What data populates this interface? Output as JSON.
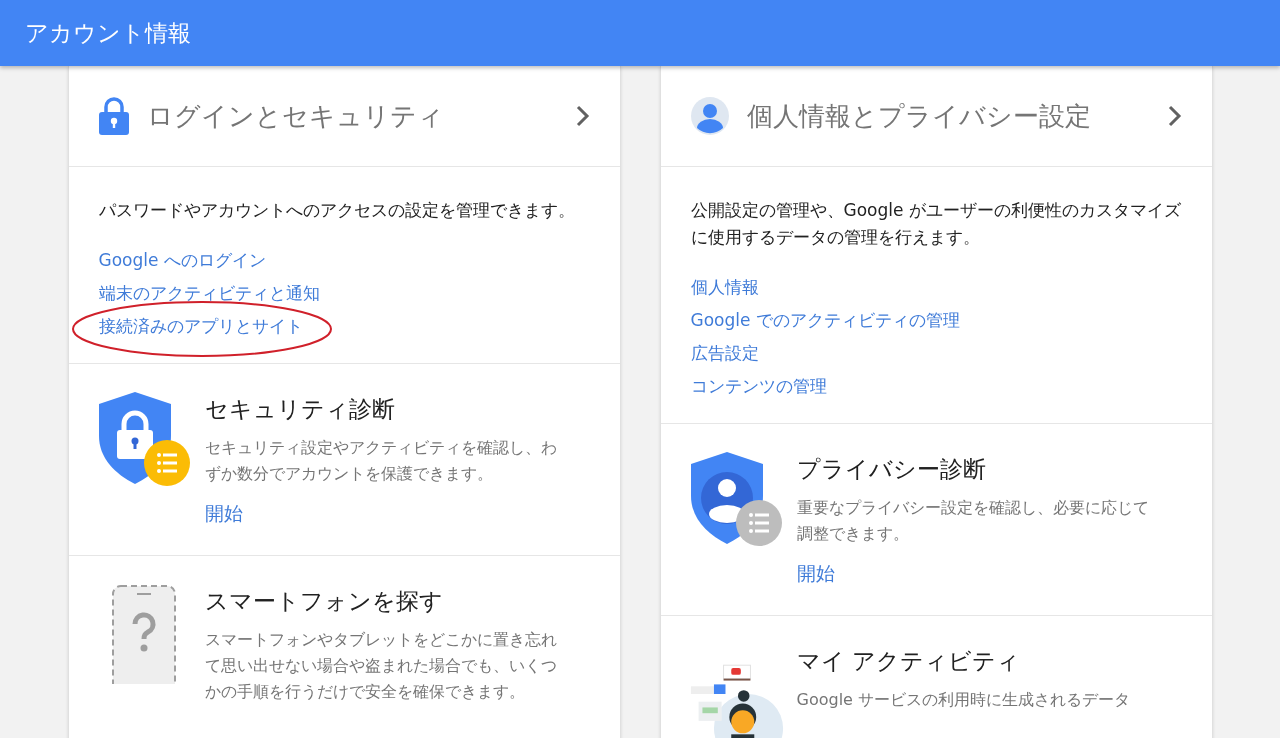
{
  "header": {
    "title": "アカウント情報"
  },
  "cards": [
    {
      "title": "ログインとセキュリティ",
      "kind": "lock",
      "description": "パスワードやアカウントへのアクセスの設定を管理できます。",
      "links": [
        {
          "label": "Google へのログイン",
          "circled": false
        },
        {
          "label": "端末のアクティビティと通知",
          "circled": false
        },
        {
          "label": "接続済みのアプリとサイト",
          "circled": true
        }
      ],
      "features": [
        {
          "kind": "security-shield",
          "title": "セキュリティ診断",
          "description": "セキュリティ設定やアクティビティを確認し、わずか数分でアカウントを保護できます。",
          "action": "開始"
        },
        {
          "kind": "phone",
          "title": "スマートフォンを探す",
          "description": "スマートフォンやタブレットをどこかに置き忘れて思い出せない場合や盗まれた場合でも、いくつかの手順を行うだけで安全を確保できます。"
        }
      ]
    },
    {
      "title": "個人情報とプライバシー設定",
      "kind": "person",
      "description": "公開設定の管理や、Google がユーザーの利便性のカスタマイズに使用するデータの管理を行えます。",
      "links": [
        {
          "label": "個人情報",
          "circled": false
        },
        {
          "label": "Google でのアクティビティの管理",
          "circled": false
        },
        {
          "label": "広告設定",
          "circled": false
        },
        {
          "label": "コンテンツの管理",
          "circled": false
        }
      ],
      "features": [
        {
          "kind": "privacy-shield",
          "title": "プライバシー診断",
          "description": "重要なプライバシー設定を確認し、必要に応じて調整できます。",
          "action": "開始"
        },
        {
          "kind": "activity",
          "title": "マイ アクティビティ",
          "description": "Google サービスの利用時に生成されるデータ"
        }
      ]
    }
  ]
}
